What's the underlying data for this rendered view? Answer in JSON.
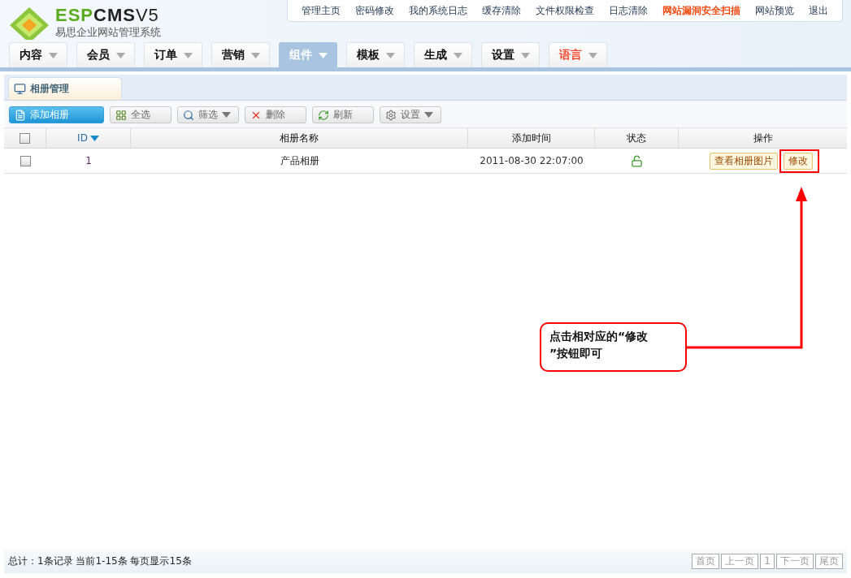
{
  "logo": {
    "brand": "ESPCMS",
    "version": "V5",
    "subtitle": "易思企业网站管理系统"
  },
  "top_links": [
    {
      "label": "管理主页",
      "highlight": false
    },
    {
      "label": "密码修改",
      "highlight": false
    },
    {
      "label": "我的系统日志",
      "highlight": false
    },
    {
      "label": "缓存清除",
      "highlight": false
    },
    {
      "label": "文件权限检查",
      "highlight": false
    },
    {
      "label": "日志清除",
      "highlight": false
    },
    {
      "label": "网站漏洞安全扫描",
      "highlight": true
    },
    {
      "label": "网站预览",
      "highlight": false
    },
    {
      "label": "退出",
      "highlight": false
    }
  ],
  "menu": [
    {
      "label": "内容",
      "selected": false,
      "highlight": false
    },
    {
      "label": "会员",
      "selected": false,
      "highlight": false
    },
    {
      "label": "订单",
      "selected": false,
      "highlight": false
    },
    {
      "label": "营销",
      "selected": false,
      "highlight": false
    },
    {
      "label": "组件",
      "selected": true,
      "highlight": false
    },
    {
      "label": "模板",
      "selected": false,
      "highlight": false
    },
    {
      "label": "生成",
      "selected": false,
      "highlight": false
    },
    {
      "label": "设置",
      "selected": false,
      "highlight": false
    },
    {
      "label": "语言",
      "selected": false,
      "highlight": true
    }
  ],
  "panel_tab": "相册管理",
  "toolbar": [
    {
      "label": "添加相册",
      "kind": "add",
      "primary": true,
      "dropdown": false
    },
    {
      "label": "全选",
      "kind": "select-all",
      "primary": false,
      "dropdown": false
    },
    {
      "label": "筛选",
      "kind": "filter",
      "primary": false,
      "dropdown": true
    },
    {
      "label": "删除",
      "kind": "delete",
      "primary": false,
      "dropdown": false
    },
    {
      "label": "刷新",
      "kind": "refresh",
      "primary": false,
      "dropdown": false
    },
    {
      "label": "设置",
      "kind": "settings",
      "primary": false,
      "dropdown": true
    }
  ],
  "table": {
    "header_checked": false,
    "columns": [
      {
        "label": "ID",
        "sorted": true
      },
      {
        "label": "相册名称",
        "sorted": false
      },
      {
        "label": "添加时间",
        "sorted": false
      },
      {
        "label": "状态",
        "sorted": false
      },
      {
        "label": "操作",
        "sorted": false
      }
    ],
    "rows": [
      {
        "checked": false,
        "id": "1",
        "name": "产品相册",
        "time": "2011-08-30 22:07:00",
        "unlocked": true,
        "actions": [
          {
            "label": "查看相册图片",
            "highlighted": false
          },
          {
            "label": "修改",
            "highlighted": true
          }
        ]
      }
    ]
  },
  "footer": {
    "summary": "总计：1条记录 当前1-15条 每页显示15条",
    "pager": [
      "首页",
      "上一页",
      "1",
      "下一页",
      "尾页"
    ]
  },
  "callout": {
    "lines": [
      "点击相对应的“修改",
      "”按钮即可"
    ]
  }
}
